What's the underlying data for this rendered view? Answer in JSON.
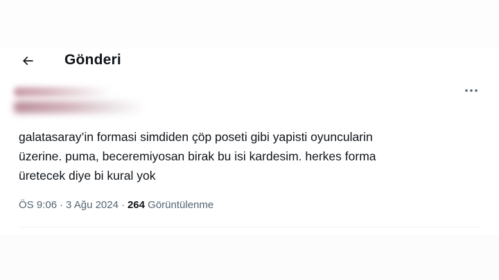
{
  "header": {
    "back_icon": "arrow-left-icon",
    "title": "Gönderi"
  },
  "tweet": {
    "author_redacted": true,
    "more_icon": "more-horizontal-icon",
    "text": "galatasaray’in formasi simdiden çöp poseti gibi yapisti oyuncularin\nüzerine. puma, beceremiyosan birak bu isi kardesim. herkes forma\nüretecek diye bi kural yok",
    "time": "ÖS 9:06",
    "date": "3 Ağu 2024",
    "views_count": "264",
    "views_label": "Görüntülenme",
    "separator": "·"
  },
  "colors": {
    "text_primary": "#0f1419",
    "text_secondary": "#536471",
    "divider": "#eff3f4"
  }
}
